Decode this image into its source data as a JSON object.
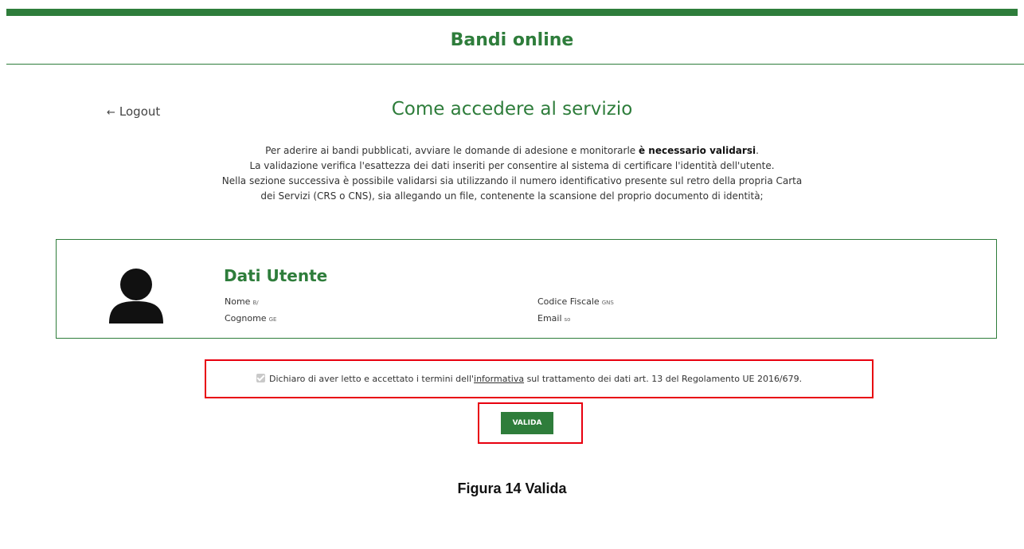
{
  "header": {
    "app_title": "Bandi online"
  },
  "nav": {
    "logout_label": "Logout",
    "logout_arrow": "←"
  },
  "main": {
    "page_title": "Come accedere al servizio",
    "intro": {
      "line1_prefix": "Per aderire ai bandi pubblicati, avviare le domande di adesione e monitorarle ",
      "line1_bold": "è necessario validarsi",
      "line1_suffix": ".",
      "line2": "La validazione verifica l'esattezza dei dati inseriti per consentire al sistema di certificare l'identità dell'utente.",
      "line3": "Nella sezione successiva è possibile validarsi sia utilizzando il numero identificativo presente sul retro della propria Carta",
      "line4": "dei Servizi (CRS o CNS), sia allegando un file, contenente la scansione del proprio documento di identità;"
    }
  },
  "user_card": {
    "title": "Dati Utente",
    "avatar_icon": "user-silhouette-icon",
    "fields": {
      "nome_label": "Nome",
      "nome_value": "B/",
      "cognome_label": "Cognome",
      "cognome_value": "GE",
      "codice_fiscale_label": "Codice Fiscale",
      "codice_fiscale_value": "GNS",
      "email_label": "Email",
      "email_value": "so"
    }
  },
  "consent": {
    "checked": true,
    "text_before": "Dichiaro di aver letto e accettato i termini dell'",
    "link_text": "informativa",
    "text_after": " sul trattamento dei dati art. 13 del Regolamento UE 2016/679."
  },
  "actions": {
    "valida_label": "VALIDA"
  },
  "caption": "Figura 14 Valida",
  "colors": {
    "brand_green": "#2e7d3b",
    "highlight_red": "#e8000f"
  }
}
